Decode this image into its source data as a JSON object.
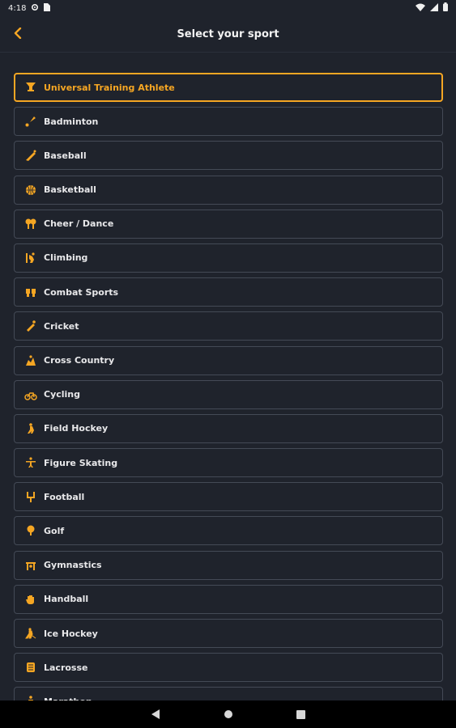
{
  "status_bar": {
    "time": "4:18",
    "icons": [
      "settings-icon",
      "sim-icon",
      "wifi-icon",
      "signal-icon",
      "battery-icon"
    ]
  },
  "app_bar": {
    "title": "Select your sport",
    "back_icon": "chevron-left-icon"
  },
  "accent_color": "#f5a623",
  "sports": [
    {
      "label": "Universal Training Athlete",
      "icon": "trophy-icon",
      "selected": true
    },
    {
      "label": "Badminton",
      "icon": "shuttlecock-icon"
    },
    {
      "label": "Baseball",
      "icon": "baseball-bat-icon"
    },
    {
      "label": "Basketball",
      "icon": "basketball-icon"
    },
    {
      "label": "Cheer / Dance",
      "icon": "pompom-icon"
    },
    {
      "label": "Climbing",
      "icon": "climbing-icon"
    },
    {
      "label": "Combat Sports",
      "icon": "boxing-icon"
    },
    {
      "label": "Cricket",
      "icon": "cricket-bat-icon"
    },
    {
      "label": "Cross Country",
      "icon": "runner-icon"
    },
    {
      "label": "Cycling",
      "icon": "bicycle-icon"
    },
    {
      "label": "Field Hockey",
      "icon": "hockey-player-icon"
    },
    {
      "label": "Figure Skating",
      "icon": "skater-icon"
    },
    {
      "label": "Football",
      "icon": "goalpost-icon"
    },
    {
      "label": "Golf",
      "icon": "golf-ball-icon"
    },
    {
      "label": "Gymnastics",
      "icon": "gymnastics-icon"
    },
    {
      "label": "Handball",
      "icon": "hand-icon"
    },
    {
      "label": "Ice Hockey",
      "icon": "ice-hockey-icon"
    },
    {
      "label": "Lacrosse",
      "icon": "lacrosse-icon"
    },
    {
      "label": "Marathon",
      "icon": "marathon-icon"
    }
  ],
  "nav_bar": {
    "icons": [
      "back-triangle-icon",
      "home-circle-icon",
      "recents-square-icon"
    ]
  }
}
